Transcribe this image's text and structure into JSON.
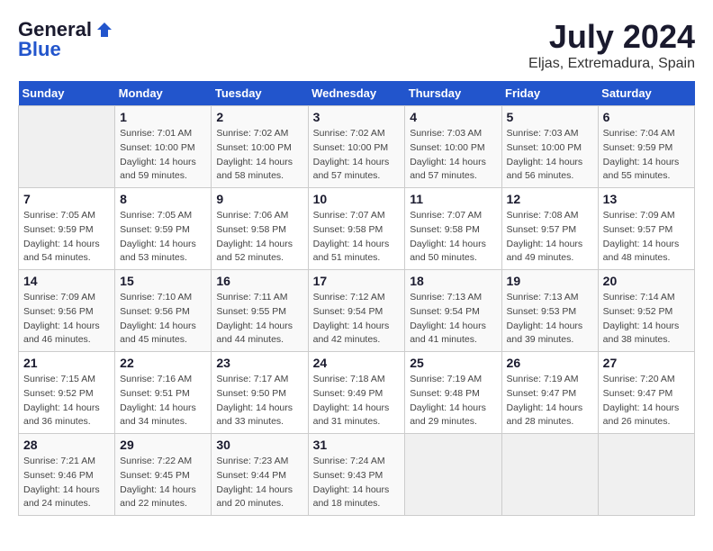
{
  "logo": {
    "general": "General",
    "blue": "Blue"
  },
  "title": "July 2024",
  "subtitle": "Eljas, Extremadura, Spain",
  "weekdays": [
    "Sunday",
    "Monday",
    "Tuesday",
    "Wednesday",
    "Thursday",
    "Friday",
    "Saturday"
  ],
  "weeks": [
    [
      {
        "day": "",
        "info": ""
      },
      {
        "day": "1",
        "info": "Sunrise: 7:01 AM\nSunset: 10:00 PM\nDaylight: 14 hours\nand 59 minutes."
      },
      {
        "day": "2",
        "info": "Sunrise: 7:02 AM\nSunset: 10:00 PM\nDaylight: 14 hours\nand 58 minutes."
      },
      {
        "day": "3",
        "info": "Sunrise: 7:02 AM\nSunset: 10:00 PM\nDaylight: 14 hours\nand 57 minutes."
      },
      {
        "day": "4",
        "info": "Sunrise: 7:03 AM\nSunset: 10:00 PM\nDaylight: 14 hours\nand 57 minutes."
      },
      {
        "day": "5",
        "info": "Sunrise: 7:03 AM\nSunset: 10:00 PM\nDaylight: 14 hours\nand 56 minutes."
      },
      {
        "day": "6",
        "info": "Sunrise: 7:04 AM\nSunset: 9:59 PM\nDaylight: 14 hours\nand 55 minutes."
      }
    ],
    [
      {
        "day": "7",
        "info": "Sunrise: 7:05 AM\nSunset: 9:59 PM\nDaylight: 14 hours\nand 54 minutes."
      },
      {
        "day": "8",
        "info": "Sunrise: 7:05 AM\nSunset: 9:59 PM\nDaylight: 14 hours\nand 53 minutes."
      },
      {
        "day": "9",
        "info": "Sunrise: 7:06 AM\nSunset: 9:58 PM\nDaylight: 14 hours\nand 52 minutes."
      },
      {
        "day": "10",
        "info": "Sunrise: 7:07 AM\nSunset: 9:58 PM\nDaylight: 14 hours\nand 51 minutes."
      },
      {
        "day": "11",
        "info": "Sunrise: 7:07 AM\nSunset: 9:58 PM\nDaylight: 14 hours\nand 50 minutes."
      },
      {
        "day": "12",
        "info": "Sunrise: 7:08 AM\nSunset: 9:57 PM\nDaylight: 14 hours\nand 49 minutes."
      },
      {
        "day": "13",
        "info": "Sunrise: 7:09 AM\nSunset: 9:57 PM\nDaylight: 14 hours\nand 48 minutes."
      }
    ],
    [
      {
        "day": "14",
        "info": "Sunrise: 7:09 AM\nSunset: 9:56 PM\nDaylight: 14 hours\nand 46 minutes."
      },
      {
        "day": "15",
        "info": "Sunrise: 7:10 AM\nSunset: 9:56 PM\nDaylight: 14 hours\nand 45 minutes."
      },
      {
        "day": "16",
        "info": "Sunrise: 7:11 AM\nSunset: 9:55 PM\nDaylight: 14 hours\nand 44 minutes."
      },
      {
        "day": "17",
        "info": "Sunrise: 7:12 AM\nSunset: 9:54 PM\nDaylight: 14 hours\nand 42 minutes."
      },
      {
        "day": "18",
        "info": "Sunrise: 7:13 AM\nSunset: 9:54 PM\nDaylight: 14 hours\nand 41 minutes."
      },
      {
        "day": "19",
        "info": "Sunrise: 7:13 AM\nSunset: 9:53 PM\nDaylight: 14 hours\nand 39 minutes."
      },
      {
        "day": "20",
        "info": "Sunrise: 7:14 AM\nSunset: 9:52 PM\nDaylight: 14 hours\nand 38 minutes."
      }
    ],
    [
      {
        "day": "21",
        "info": "Sunrise: 7:15 AM\nSunset: 9:52 PM\nDaylight: 14 hours\nand 36 minutes."
      },
      {
        "day": "22",
        "info": "Sunrise: 7:16 AM\nSunset: 9:51 PM\nDaylight: 14 hours\nand 34 minutes."
      },
      {
        "day": "23",
        "info": "Sunrise: 7:17 AM\nSunset: 9:50 PM\nDaylight: 14 hours\nand 33 minutes."
      },
      {
        "day": "24",
        "info": "Sunrise: 7:18 AM\nSunset: 9:49 PM\nDaylight: 14 hours\nand 31 minutes."
      },
      {
        "day": "25",
        "info": "Sunrise: 7:19 AM\nSunset: 9:48 PM\nDaylight: 14 hours\nand 29 minutes."
      },
      {
        "day": "26",
        "info": "Sunrise: 7:19 AM\nSunset: 9:47 PM\nDaylight: 14 hours\nand 28 minutes."
      },
      {
        "day": "27",
        "info": "Sunrise: 7:20 AM\nSunset: 9:47 PM\nDaylight: 14 hours\nand 26 minutes."
      }
    ],
    [
      {
        "day": "28",
        "info": "Sunrise: 7:21 AM\nSunset: 9:46 PM\nDaylight: 14 hours\nand 24 minutes."
      },
      {
        "day": "29",
        "info": "Sunrise: 7:22 AM\nSunset: 9:45 PM\nDaylight: 14 hours\nand 22 minutes."
      },
      {
        "day": "30",
        "info": "Sunrise: 7:23 AM\nSunset: 9:44 PM\nDaylight: 14 hours\nand 20 minutes."
      },
      {
        "day": "31",
        "info": "Sunrise: 7:24 AM\nSunset: 9:43 PM\nDaylight: 14 hours\nand 18 minutes."
      },
      {
        "day": "",
        "info": ""
      },
      {
        "day": "",
        "info": ""
      },
      {
        "day": "",
        "info": ""
      }
    ]
  ]
}
